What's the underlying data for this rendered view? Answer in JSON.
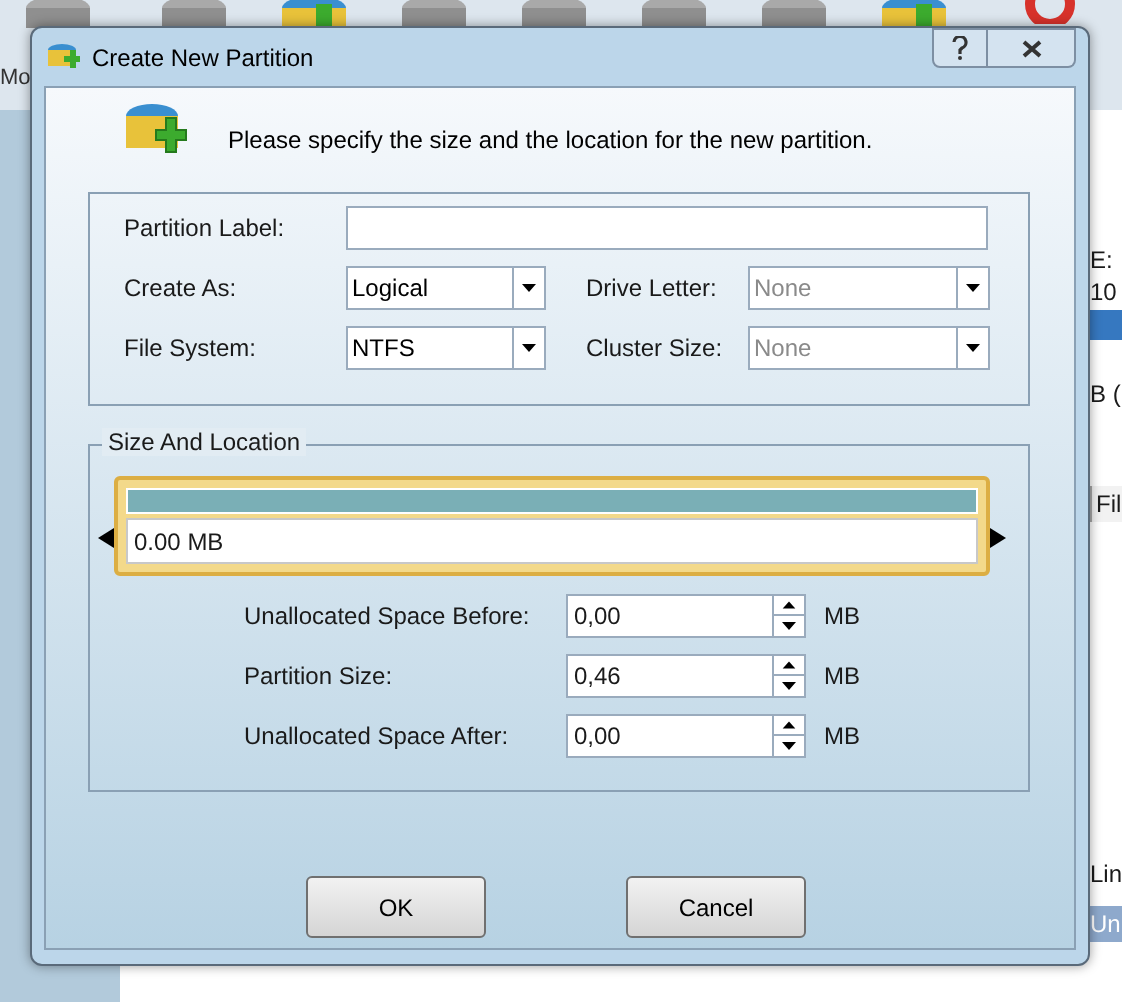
{
  "background": {
    "toolbar_fragment": "Mo",
    "side_fragments": [
      {
        "text": "E:",
        "kind": "plain"
      },
      {
        "text": "10",
        "kind": "plain"
      },
      {
        "text": "B (",
        "kind": "plain"
      },
      {
        "text": "Fil",
        "kind": "header"
      },
      {
        "text": "Lin",
        "kind": "plain"
      },
      {
        "text": "Un",
        "kind": "selected"
      }
    ]
  },
  "window": {
    "title": "Create New Partition"
  },
  "instruction": "Please specify the size and the location for the new partition.",
  "partition_label": {
    "label": "Partition Label:"
  },
  "combos": [
    {
      "label": "Create As:",
      "value": "Logical",
      "disabled": false
    },
    {
      "label": "Drive Letter:",
      "value": "None",
      "disabled": true
    },
    {
      "label": "File System:",
      "value": "NTFS",
      "disabled": false
    },
    {
      "label": "Cluster Size:",
      "value": "None",
      "disabled": true
    }
  ],
  "size_and_location": {
    "title": "Size And Location",
    "bar_reading": "0.00 MB",
    "spinners": [
      {
        "label": "Unallocated Space Before:",
        "value": "0,00",
        "unit": "MB"
      },
      {
        "label": "Partition Size:",
        "value": "0,46",
        "unit": "MB"
      },
      {
        "label": "Unallocated Space After:",
        "value": "0,00",
        "unit": "MB"
      }
    ]
  },
  "buttons": [
    "OK",
    "Cancel"
  ]
}
